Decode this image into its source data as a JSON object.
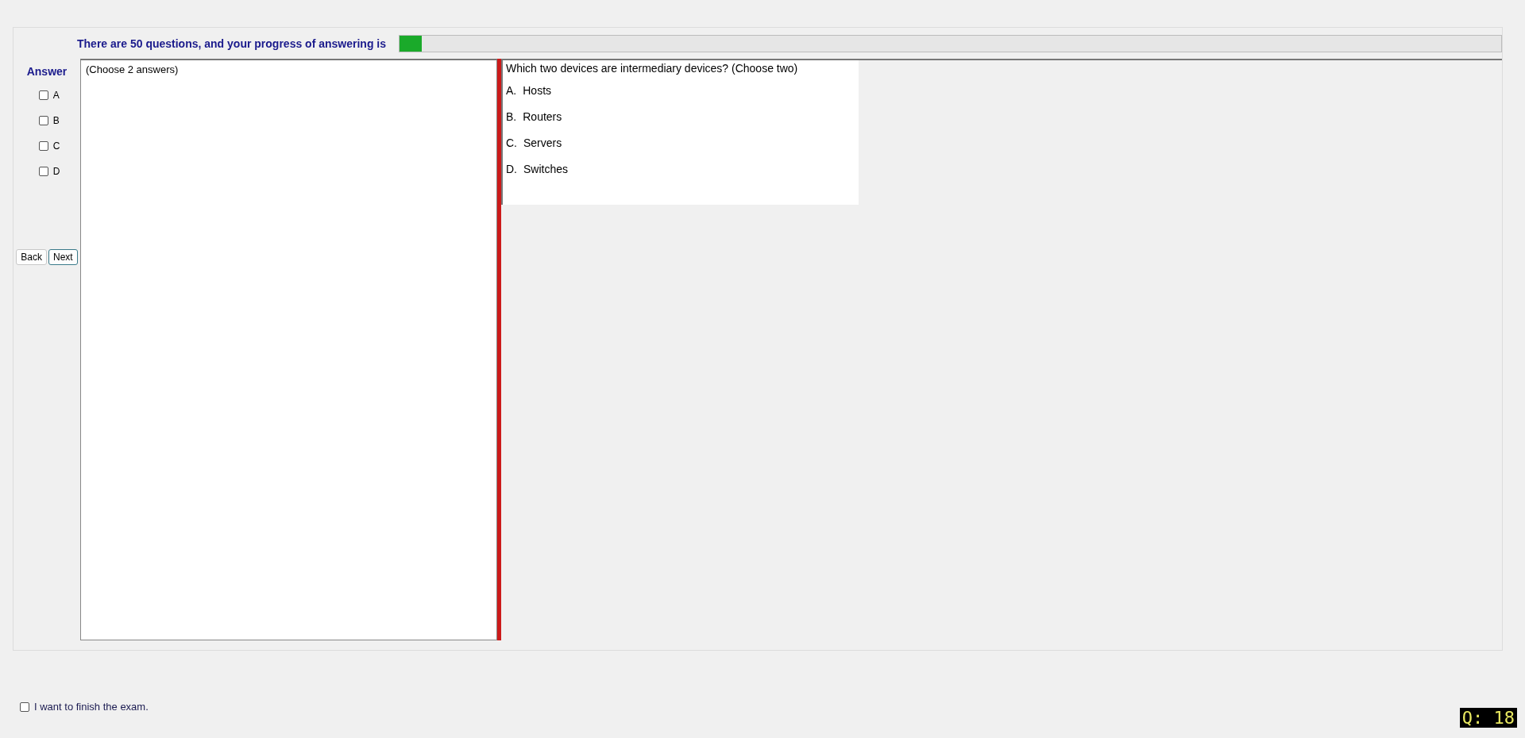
{
  "progress": {
    "label": "There are 50 questions, and your progress of answering is",
    "level": 0.02
  },
  "answer": {
    "title": "Answer",
    "options": [
      {
        "label": "A",
        "checked": false
      },
      {
        "label": "B",
        "checked": false
      },
      {
        "label": "C",
        "checked": false
      },
      {
        "label": "D",
        "checked": false
      }
    ],
    "buttons": [
      {
        "label": "Back",
        "focused": false
      },
      {
        "label": "Next",
        "focused": true
      }
    ]
  },
  "answer_text": "(Choose 2 answers)",
  "question": {
    "text": "Which two devices are intermediary devices? (Choose two)",
    "choices": [
      {
        "letter": "A.",
        "text": "Hosts"
      },
      {
        "letter": "B.",
        "text": "Routers"
      },
      {
        "letter": "C.",
        "text": "Servers"
      },
      {
        "letter": "D.",
        "text": "Switches"
      }
    ]
  },
  "finish": {
    "label": "I want to finish the exam.",
    "checked": false
  },
  "question_number": "Q: 18"
}
